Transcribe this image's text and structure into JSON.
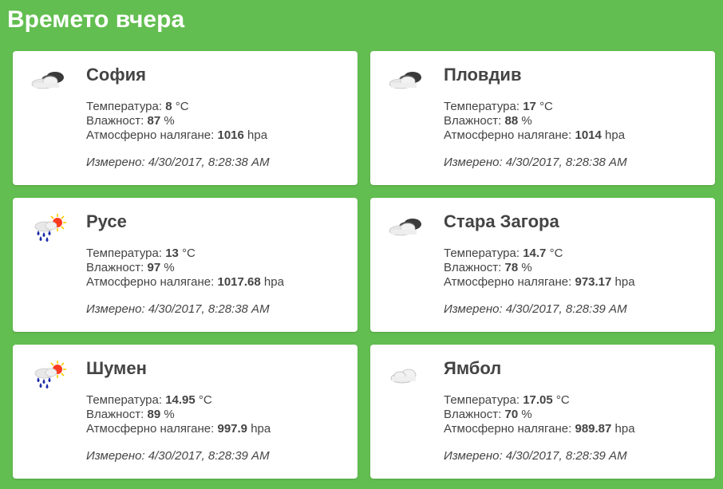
{
  "page": {
    "title": "Времето вчера"
  },
  "labels": {
    "temperature": "Температура:",
    "humidity": "Влажност:",
    "pressure": "Атмосферно налягане:",
    "measured": "Измерено:"
  },
  "units": {
    "temperature": "°C",
    "humidity": "%",
    "pressure": "hpa"
  },
  "cards": [
    {
      "city": "София",
      "icon": "broken-clouds-icon",
      "temperature": "8",
      "humidity": "87",
      "pressure": "1016",
      "measured": "4/30/2017, 8:28:38 AM"
    },
    {
      "city": "Пловдив",
      "icon": "broken-clouds-icon",
      "temperature": "17",
      "humidity": "88",
      "pressure": "1014",
      "measured": "4/30/2017, 8:28:38 AM"
    },
    {
      "city": "Русе",
      "icon": "sun-rain-icon",
      "temperature": "13",
      "humidity": "97",
      "pressure": "1017.68",
      "measured": "4/30/2017, 8:28:38 AM"
    },
    {
      "city": "Стара Загора",
      "icon": "broken-clouds-icon",
      "temperature": "14.7",
      "humidity": "78",
      "pressure": "973.17",
      "measured": "4/30/2017, 8:28:39 AM"
    },
    {
      "city": "Шумен",
      "icon": "sun-rain-icon",
      "temperature": "14.95",
      "humidity": "89",
      "pressure": "997.9",
      "measured": "4/30/2017, 8:28:39 AM"
    },
    {
      "city": "Ямбол",
      "icon": "cloud-icon",
      "temperature": "17.05",
      "humidity": "70",
      "pressure": "989.87",
      "measured": "4/30/2017, 8:28:39 AM"
    }
  ],
  "colors": {
    "background": "#62be50",
    "card": "#ffffff",
    "text": "#444444",
    "sun": "#ff3b1f",
    "sun_ray": "#ffcc00",
    "rain": "#1a2aa8"
  }
}
